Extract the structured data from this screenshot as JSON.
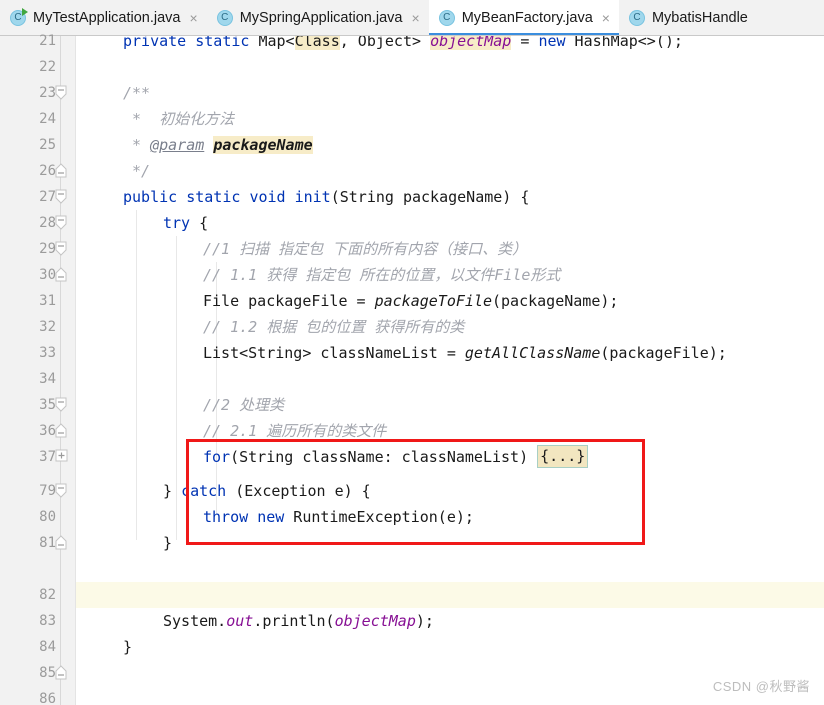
{
  "window": {
    "app": "IntelliJ IDEA",
    "view": "java-editor"
  },
  "tabs": [
    {
      "label": "MyTestApplication.java",
      "icon": "java-class-runnable-icon",
      "close": "×",
      "letter": "C",
      "active": false,
      "runnable": true
    },
    {
      "label": "MySpringApplication.java",
      "icon": "java-class-icon",
      "close": "×",
      "letter": "C",
      "active": false,
      "runnable": false
    },
    {
      "label": "MyBeanFactory.java",
      "icon": "java-class-icon",
      "close": "×",
      "letter": "C",
      "active": true,
      "runnable": false
    },
    {
      "label": "MybatisHandle",
      "icon": "java-class-icon",
      "close": "",
      "letter": "C",
      "active": false,
      "runnable": false
    }
  ],
  "editor": {
    "active_file": "MyBeanFactory.java",
    "caret_line": 82,
    "line_numbers": [
      21,
      22,
      23,
      24,
      25,
      26,
      27,
      28,
      29,
      30,
      31,
      32,
      33,
      34,
      35,
      36,
      37,
      79,
      80,
      81,
      82,
      83,
      84,
      85,
      86
    ],
    "fold_markers": {
      "23": "collapse-down",
      "26": "collapse-up",
      "27": "collapse-down",
      "28": "collapse-down",
      "29": "collapse-down",
      "30": "collapse-up",
      "35": "collapse-down",
      "36": "collapse-up",
      "37": "expand-plus",
      "79": "collapse-down",
      "81": "collapse-up",
      "84": "collapse-up"
    },
    "lines": {
      "21": "private static Map<Class, Object> objectMap = new HashMap<>();",
      "22": "",
      "23": "/**",
      "24": " *  初始化方法",
      "25": " * @param packageName",
      "26": " */",
      "27": "public static void init(String packageName) {",
      "28": "    try {",
      "29": "        //1 扫描 指定包 下面的所有内容（接口、类）",
      "30": "        // 1.1 获得 指定包 所在的位置，以文件File形式",
      "31": "        File packageFile = packageToFile(packageName);",
      "32": "        // 1.2 根据 包的位置 获得所有的类",
      "33": "        List<String> classNameList = getAllClassName(packageFile);",
      "34": "",
      "35": "        //2 处理类",
      "36": "        // 2.1 遍历所有的类文件",
      "37": "        for(String className: classNameList) {...}",
      "79": "    } catch (Exception e) {",
      "80": "        throw new RuntimeException(e);",
      "81": "    }",
      "82": "",
      "83": "    System.out.println(objectMap);",
      "84": "}",
      "85": "",
      "86": ""
    },
    "tokens": {
      "l21_kw1": "private",
      "l21_kw2": "static",
      "l21_type": "Map<",
      "l21_class": "Class",
      "l21_rest": ", Object> ",
      "l21_field": "objectMap",
      "l21_eq": " = ",
      "l21_new": "new",
      "l21_hash": " HashMap<>();",
      "l23_doc": "/**",
      "l24_star": " *  ",
      "l24_text": "初始化方法",
      "l25_star": " * ",
      "l25_tag": "@param",
      "l25_param": "packageName",
      "l26_doc": " */",
      "l27_kw1": "public",
      "l27_kw2": "static",
      "l27_kw3": "void",
      "l27_name": "init",
      "l27_sig": "(String packageName) {",
      "l28_kw": "try",
      "l28_brace": " {",
      "l29_cmt": "//1 扫描 指定包 下面的所有内容（接口、类）",
      "l30_cmt": "// 1.1 获得 指定包 所在的位置，以文件File形式",
      "l31_a": "File packageFile = ",
      "l31_m": "packageToFile",
      "l31_b": "(packageName);",
      "l32_cmt": "// 1.2 根据 包的位置 获得所有的类",
      "l33_a": "List<String> classNameList = ",
      "l33_m": "getAllClassName",
      "l33_b": "(packageFile);",
      "l35_cmt": "//2 处理类",
      "l36_cmt": "// 2.1 遍历所有的类文件",
      "l37_kw": "for",
      "l37_body": "(String className: classNameList) ",
      "l37_fold": "{...}",
      "l79_close": "} ",
      "l79_kw": "catch",
      "l79_rest": " (Exception e) {",
      "l80_kw1": "throw",
      "l80_kw2": "new",
      "l80_rest": " RuntimeException(e);",
      "l81_brace": "}",
      "l83_a": "System.",
      "l83_out": "out",
      "l83_b": ".println(",
      "l83_field": "objectMap",
      "l83_c": ");",
      "l84_brace": "}"
    }
  },
  "annotation": {
    "type": "red-rectangle",
    "covers_lines": "35-37"
  },
  "watermark": {
    "text": "CSDN @秋野酱"
  },
  "colors": {
    "keyword": "#0033b3",
    "comment": "#a2a5ad",
    "field": "#871094",
    "highlight": "#f7ecc8",
    "caret_line": "#fcfae7",
    "annotation": "#f01818",
    "tab_active_underline": "#3b8ede",
    "gutter_bg": "#f2f2f2"
  }
}
